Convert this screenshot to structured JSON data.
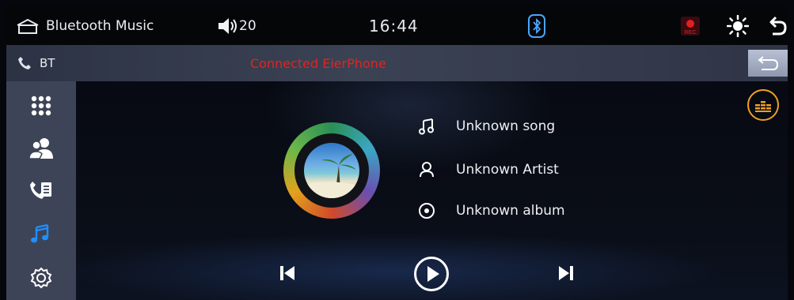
{
  "status_bar": {
    "title": "Bluetooth Music",
    "volume": "20",
    "time": "16:44",
    "icons": [
      "home-icon",
      "speaker-icon",
      "bluetooth-icon",
      "record-icon",
      "brightness-icon",
      "back-arrow-icon"
    ],
    "rec_label": "REC"
  },
  "sub_bar": {
    "source": "BT",
    "connection": "Connected EierPhone"
  },
  "sidebar": {
    "items": [
      {
        "name": "apps",
        "icon": "grid-icon"
      },
      {
        "name": "contacts",
        "icon": "contacts-icon"
      },
      {
        "name": "call-log",
        "icon": "call-log-icon"
      },
      {
        "name": "music",
        "icon": "music-note-icon",
        "active": true
      },
      {
        "name": "settings",
        "icon": "settings-icon"
      }
    ]
  },
  "track": {
    "song": "Unknown song",
    "artist": "Unknown Artist",
    "album": "Unknown album"
  },
  "controls": [
    "previous",
    "play",
    "next"
  ],
  "colors": {
    "accent": "#1e90ff",
    "connection": "#e0241f",
    "eq": "#f0a020"
  }
}
